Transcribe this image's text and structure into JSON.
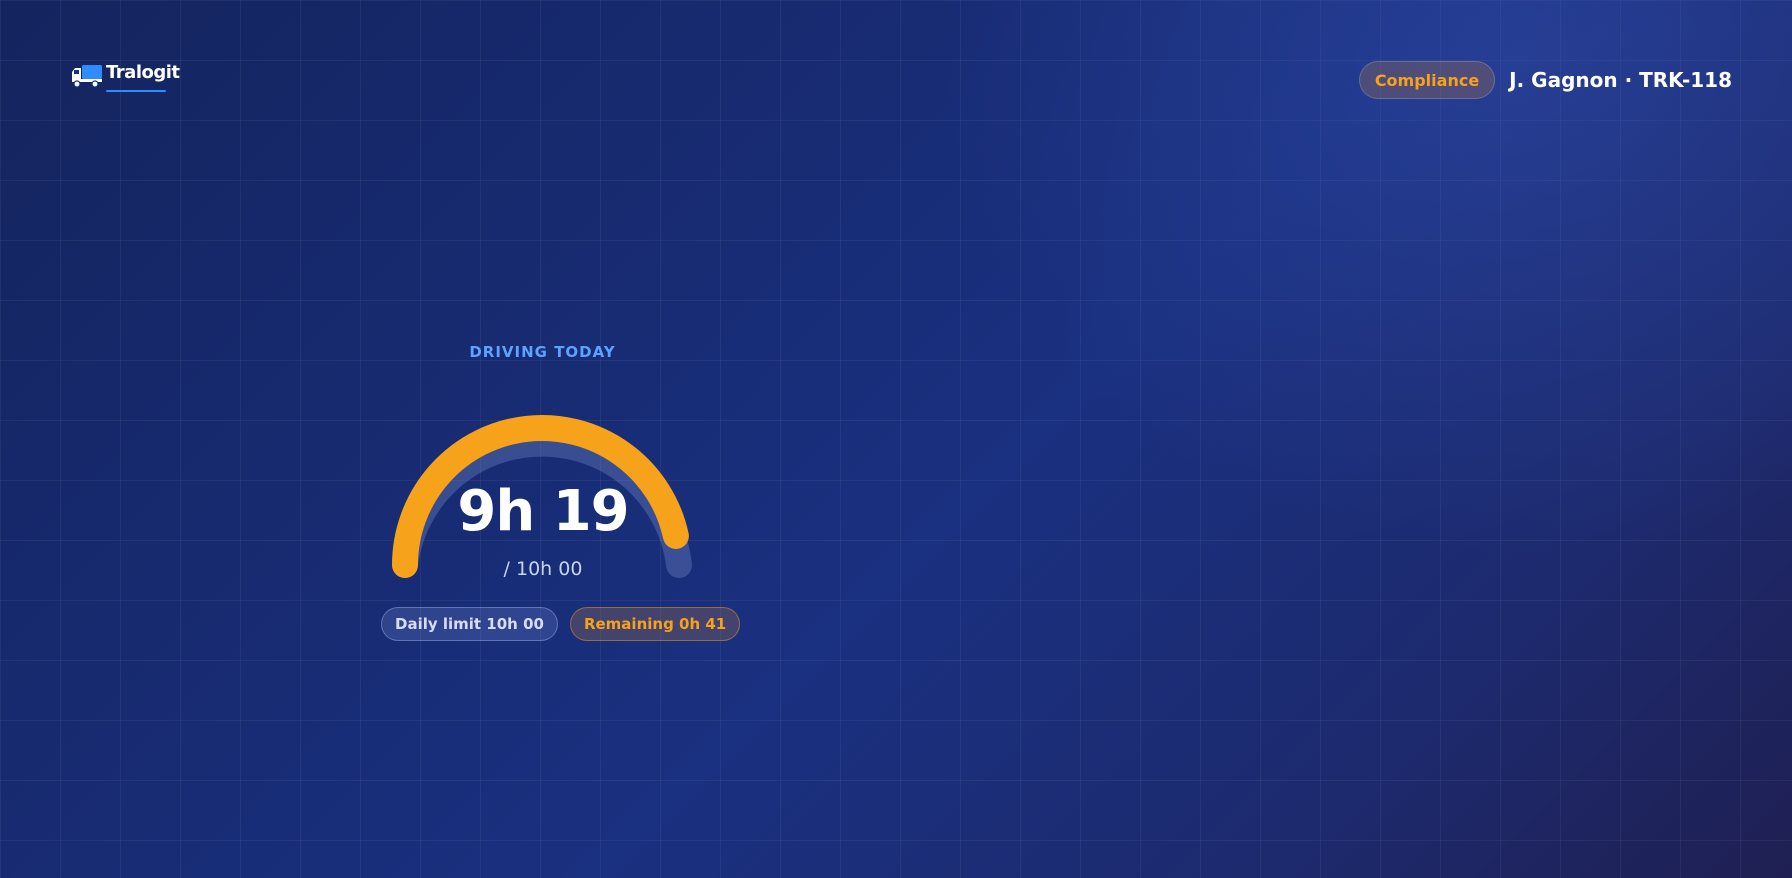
{
  "app": {
    "brand": "Tralogit",
    "logo_icon": "truck-icon"
  },
  "header": {
    "compliance_label": "Compliance",
    "driver_label": "J. Gagnon · TRK-118"
  },
  "driving": {
    "section_label": "DRIVING TODAY",
    "value": "9h 19",
    "limit_text": "/ 10h 00",
    "progress_fraction": 0.932,
    "daily_limit_chip": "Daily limit 10h 00",
    "remaining_chip": "Remaining 0h 41"
  },
  "colors": {
    "accent_orange": "#f7a21b",
    "accent_blue": "#5da2ff",
    "background": "#17287a"
  }
}
